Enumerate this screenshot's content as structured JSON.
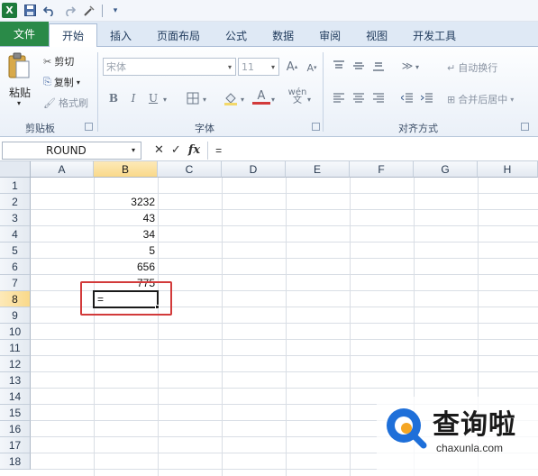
{
  "quick_access": {
    "app_icon": "excel-icon",
    "buttons": [
      "save-icon",
      "undo-icon",
      "redo-icon",
      "customize-icon"
    ]
  },
  "tabs": [
    {
      "label": "文件",
      "active": false,
      "file": true
    },
    {
      "label": "开始",
      "active": true
    },
    {
      "label": "插入",
      "active": false
    },
    {
      "label": "页面布局",
      "active": false
    },
    {
      "label": "公式",
      "active": false
    },
    {
      "label": "数据",
      "active": false
    },
    {
      "label": "审阅",
      "active": false
    },
    {
      "label": "视图",
      "active": false
    },
    {
      "label": "开发工具",
      "active": false
    }
  ],
  "ribbon": {
    "clipboard": {
      "paste": "粘贴",
      "cut": "剪切",
      "copy": "复制",
      "format_painter": "格式刷",
      "group_label": "剪贴板"
    },
    "font": {
      "font_name": "宋体",
      "font_size": "11",
      "bold": "B",
      "italic": "I",
      "underline": "U",
      "group_label": "字体"
    },
    "alignment": {
      "wrap_text": "自动换行",
      "merge_center": "合并后居中",
      "group_label": "对齐方式"
    }
  },
  "formula_bar": {
    "name_box": "ROUND",
    "cancel": "✕",
    "enter": "✓",
    "fx": "fx",
    "content": "="
  },
  "sheet": {
    "columns": [
      "A",
      "B",
      "C",
      "D",
      "E",
      "F",
      "G",
      "H"
    ],
    "selected_column": "B",
    "rows": [
      "1",
      "2",
      "3",
      "4",
      "5",
      "6",
      "7",
      "8",
      "9",
      "10",
      "11",
      "12",
      "13",
      "14",
      "15",
      "16",
      "17",
      "18"
    ],
    "selected_row": "8",
    "cells": {
      "B2": "3232",
      "B3": "43",
      "B4": "34",
      "B5": "5",
      "B6": "656",
      "B7": "775",
      "B8": "="
    },
    "highlight_color": "#d23a3a"
  },
  "watermark": {
    "title": "查询啦",
    "subtitle": "chaxunla.com",
    "logo_color": "#1e6fd9",
    "logo_accent": "#f5a623"
  }
}
